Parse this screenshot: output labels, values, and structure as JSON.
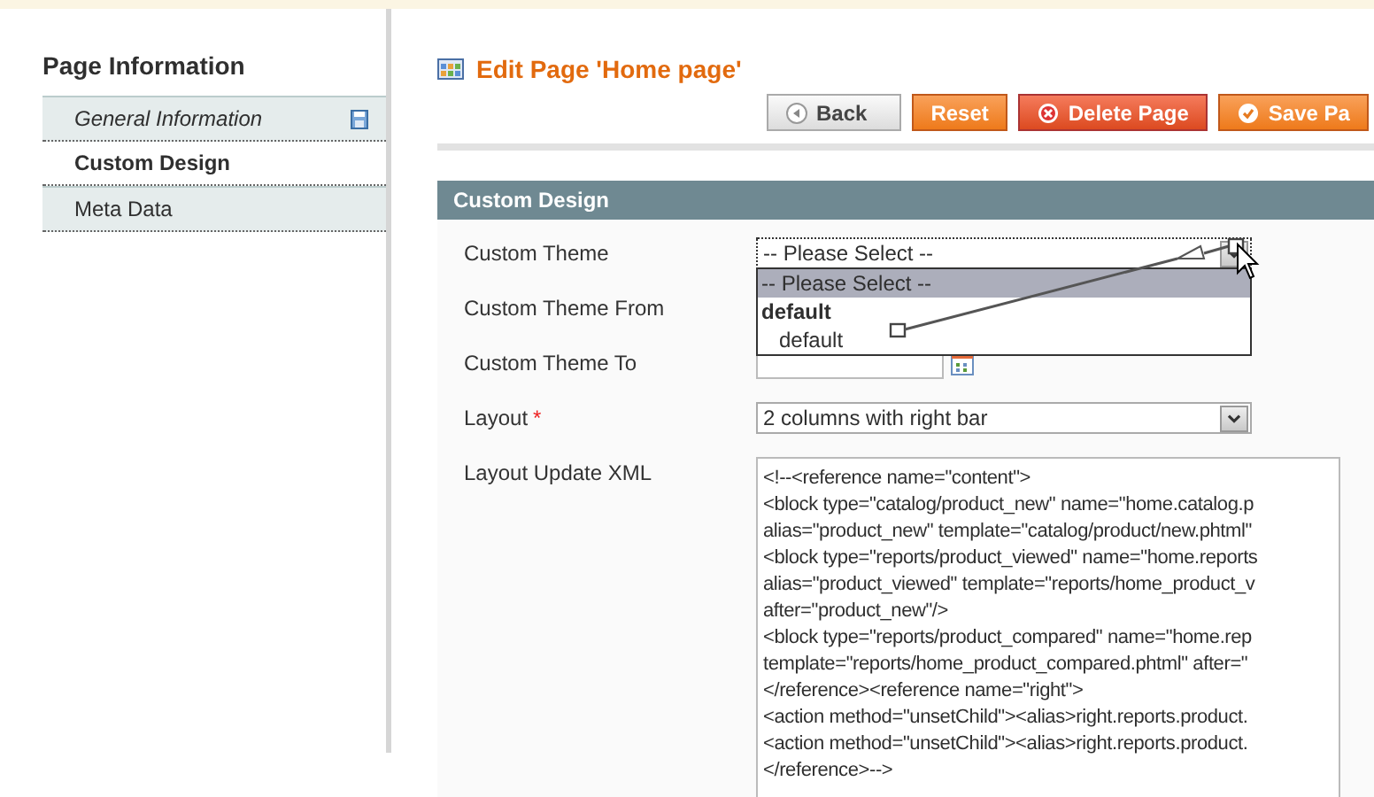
{
  "sidebar": {
    "title": "Page Information",
    "items": [
      {
        "label": "General Information",
        "selected": false,
        "changed": true
      },
      {
        "label": "Custom Design",
        "selected": true,
        "changed": false
      },
      {
        "label": "Meta Data",
        "selected": false,
        "changed": false
      }
    ]
  },
  "header": {
    "title": "Edit Page 'Home page'"
  },
  "buttons": [
    {
      "label": "Back",
      "kind": "back"
    },
    {
      "label": "Reset",
      "kind": "reset"
    },
    {
      "label": "Delete Page",
      "kind": "delete"
    },
    {
      "label": "Save Pa",
      "kind": "save"
    }
  ],
  "section": {
    "title": "Custom Design"
  },
  "fields": [
    {
      "label": "Custom Theme",
      "kind": "select",
      "value": "-- Please Select --",
      "focused": true
    },
    {
      "label": "Custom Theme From"
    },
    {
      "label": "Custom Theme To",
      "kind": "date"
    },
    {
      "label": "Layout",
      "kind": "select",
      "value": "2 columns with right bar",
      "required_mark": "*",
      "focused": false
    },
    {
      "label": "Layout Update XML",
      "kind": "textarea",
      "lines": [
        "<!--<reference name=\"content\">",
        "<block type=\"catalog/product_new\" name=\"home.catalog.p",
        "alias=\"product_new\" template=\"catalog/product/new.phtml\"",
        "<block type=\"reports/product_viewed\" name=\"home.reports",
        "alias=\"product_viewed\" template=\"reports/home_product_v",
        "after=\"product_new\"/>",
        "<block type=\"reports/product_compared\" name=\"home.rep",
        "template=\"reports/home_product_compared.phtml\" after=\"",
        "</reference><reference name=\"right\">",
        "<action method=\"unsetChild\"><alias>right.reports.product.",
        "<action method=\"unsetChild\"><alias>right.reports.product.",
        "</reference>-->"
      ]
    }
  ],
  "dropdown": {
    "options": [
      {
        "label": "-- Please Select --",
        "kind": "option",
        "selected": true
      },
      {
        "label": "default",
        "kind": "group",
        "selected": false
      },
      {
        "label": "default",
        "kind": "option",
        "selected": false
      }
    ]
  }
}
